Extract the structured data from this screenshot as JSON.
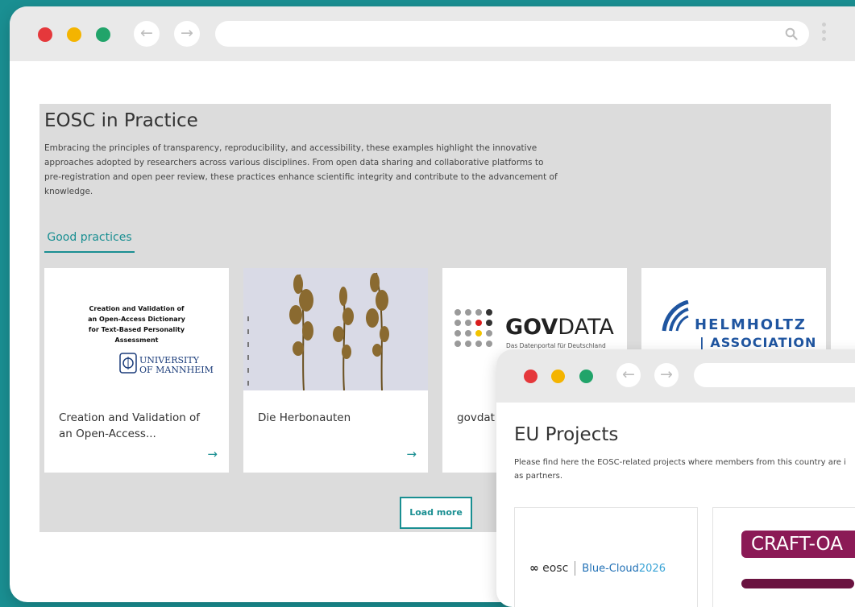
{
  "main_window": {
    "section": {
      "title": "EOSC in Practice",
      "description": "Embracing the principles of transparency, reproducibility, and accessibility, these examples highlight the innovative approaches adopted by researchers across various disciplines. From open data sharing and collaborative platforms to pre-registration and open peer review, these practices enhance scientific integrity and contribute to the advancement of knowledge.",
      "tab_label": "Good practices",
      "cards": [
        {
          "label": "Creation and Validation of an Open-Access...",
          "image_title": "Creation and Validation of an Open-Access Dictionary for Text-Based Personality Assessment",
          "logo_text_1": "UNIVERSITY",
          "logo_text_2": "OF MANNHEIM"
        },
        {
          "label": "Die Herbonauten"
        },
        {
          "label": "govdat",
          "logo_text_bold": "GOV",
          "logo_text_light": "DATA",
          "logo_subtitle": "Das Datenportal für Deutschland"
        },
        {
          "label": "",
          "logo_text_1": "HELMHOLTZ",
          "logo_text_2": "| ASSOCIATION"
        }
      ],
      "card_arrow": "→",
      "load_more_label": "Load more"
    }
  },
  "front_window": {
    "title": "EU Projects",
    "description_line1": "Please find here the EOSC-related projects where members from this country are i",
    "description_line2": "as partners.",
    "cards": [
      {
        "logo_eosc": "eosc",
        "logo_blue": "Blue-Cloud",
        "logo_year": "2026"
      },
      {
        "logo_text": "CRAFT-OA"
      }
    ]
  },
  "colors": {
    "accent": "#1a8f92",
    "background": "#1a8f92",
    "section_bg": "#dcdcdc",
    "close": "#e5383b",
    "minimize": "#f4b400",
    "maximize": "#21a46a"
  },
  "icons": [
    "back-arrow-icon",
    "forward-arrow-icon",
    "search-icon",
    "kebab-menu-icon",
    "right-arrow-icon"
  ]
}
